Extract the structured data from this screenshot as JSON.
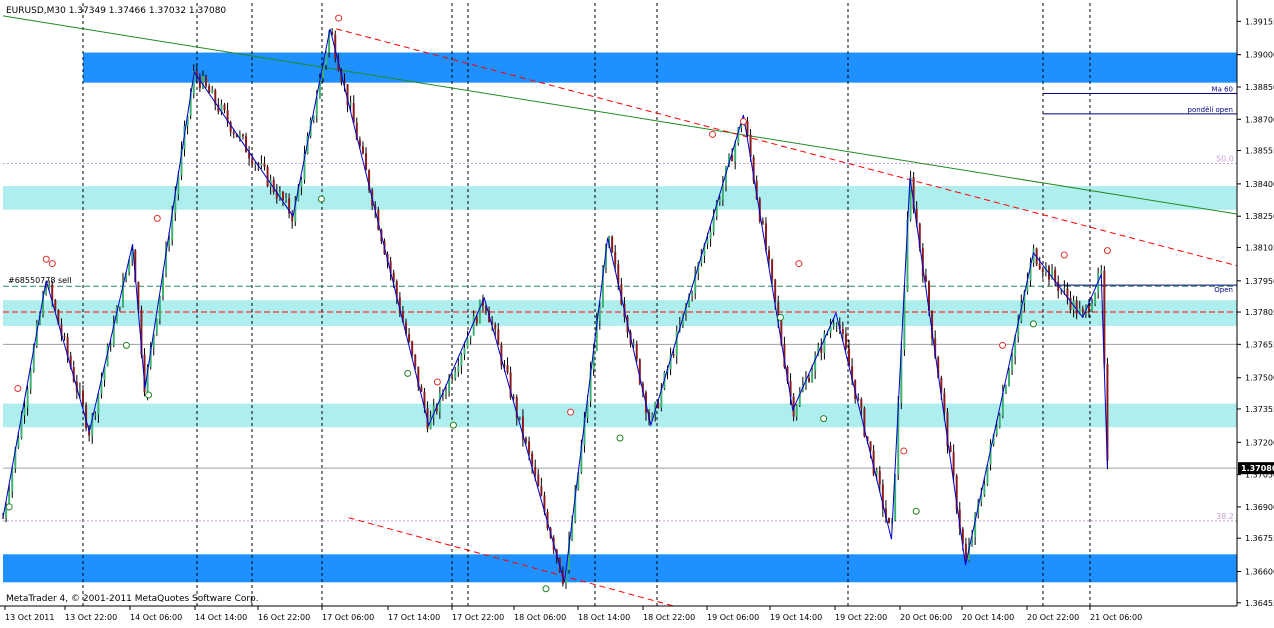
{
  "header": {
    "symbol_timeframe": "EURUSD,M30",
    "ohlc": "1.37349 1.37466 1.37032 1.37080"
  },
  "footer": {
    "copyright": "MetaTrader 4, © 2001-2011 MetaQuotes Software Corp."
  },
  "chart_data": {
    "type": "candlestick",
    "symbol": "EURUSD",
    "timeframe": "M30",
    "current_price": 1.3708,
    "current_price_label": "1.37080",
    "ylim": [
      1.3644,
      1.3924
    ],
    "y_ticks": [
      "1.39155",
      "1.39000",
      "1.38850",
      "1.38700",
      "1.38555",
      "1.38400",
      "1.38250",
      "1.38105",
      "1.37950",
      "1.37805",
      "1.37655",
      "1.37500",
      "1.37355",
      "1.37200",
      "1.37050",
      "1.36900",
      "1.36755",
      "1.36600",
      "1.36455"
    ],
    "x_labels": [
      "13 Oct 2011",
      "13 Oct 22:00",
      "14 Oct 06:00",
      "14 Oct 14:00",
      "16 Oct 22:00",
      "17 Oct 06:00",
      "17 Oct 14:00",
      "17 Oct 22:00",
      "18 Oct 06:00",
      "18 Oct 14:00",
      "18 Oct 22:00",
      "19 Oct 06:00",
      "19 Oct 14:00",
      "19 Oct 22:00",
      "20 Oct 06:00",
      "20 Oct 14:00",
      "20 Oct 22:00",
      "21 Oct 06:00"
    ],
    "zones": [
      {
        "from": 1.3887,
        "to": 1.3901,
        "color": "#1e90ff"
      },
      {
        "from": 1.3828,
        "to": 1.3839,
        "color": "#afeeee"
      },
      {
        "from": 1.3774,
        "to": 1.3786,
        "color": "#afeeee"
      },
      {
        "from": 1.3727,
        "to": 1.3738,
        "color": "#afeeee"
      },
      {
        "from": 1.3655,
        "to": 1.3668,
        "color": "#1e90ff"
      }
    ],
    "order_line": {
      "label": "#68550778 sell",
      "price": 1.37925,
      "color": "#2e8b57"
    },
    "stop_line": {
      "price": 1.37805,
      "color": "#ff0000"
    },
    "fib_levels": [
      {
        "label": "50.0",
        "price": 1.38495
      },
      {
        "label": "38.2",
        "price": 1.36835
      }
    ],
    "gray_lines": [
      1.37655,
      1.3708
    ],
    "ma_label": "Ma 60",
    "ma_price": 1.3882,
    "pond_label": "pondělí open",
    "pond_price": 1.38725,
    "open_label": "Open",
    "open_price": 1.3793,
    "trend_green": {
      "from": [
        0.0,
        1.3918
      ],
      "to": [
        1.0,
        1.3826
      ],
      "color": "#228b22"
    },
    "trend_red_upper": {
      "from": [
        0.27,
        1.3912
      ],
      "to": [
        1.0,
        1.3802
      ],
      "color": "#ff0000"
    },
    "trend_red_lower": {
      "from": [
        0.28,
        1.3685
      ],
      "to": [
        0.55,
        1.3643
      ],
      "color": "#ff0000"
    },
    "zigzag": [
      [
        0.0,
        1.3685
      ],
      [
        0.035,
        1.3795
      ],
      [
        0.07,
        1.3725
      ],
      [
        0.105,
        1.3812
      ],
      [
        0.115,
        1.3745
      ],
      [
        0.155,
        1.3892
      ],
      [
        0.235,
        1.3825
      ],
      [
        0.265,
        1.3912
      ],
      [
        0.345,
        1.3728
      ],
      [
        0.39,
        1.3787
      ],
      [
        0.455,
        1.3655
      ],
      [
        0.49,
        1.3815
      ],
      [
        0.525,
        1.3728
      ],
      [
        0.6,
        1.3872
      ],
      [
        0.64,
        1.3735
      ],
      [
        0.675,
        1.378
      ],
      [
        0.72,
        1.3675
      ],
      [
        0.735,
        1.3843
      ],
      [
        0.78,
        1.3663
      ],
      [
        0.835,
        1.3808
      ],
      [
        0.875,
        1.3778
      ],
      [
        0.89,
        1.3798
      ],
      [
        0.895,
        1.3708
      ]
    ],
    "marks_red": [
      [
        0.012,
        1.3745
      ],
      [
        0.035,
        1.3805
      ],
      [
        0.04,
        1.3803
      ],
      [
        0.125,
        1.3824
      ],
      [
        0.272,
        1.3917
      ],
      [
        0.352,
        1.3748
      ],
      [
        0.46,
        1.3734
      ],
      [
        0.575,
        1.3863
      ],
      [
        0.6,
        1.3869
      ],
      [
        0.645,
        1.3803
      ],
      [
        0.73,
        1.3716
      ],
      [
        0.81,
        1.3765
      ],
      [
        0.86,
        1.3807
      ],
      [
        0.895,
        1.3809
      ]
    ],
    "marks_green": [
      [
        0.005,
        1.369
      ],
      [
        0.1,
        1.3765
      ],
      [
        0.118,
        1.3742
      ],
      [
        0.258,
        1.3833
      ],
      [
        0.328,
        1.3752
      ],
      [
        0.365,
        1.3728
      ],
      [
        0.44,
        1.3652
      ],
      [
        0.5,
        1.3722
      ],
      [
        0.63,
        1.3778
      ],
      [
        0.665,
        1.3731
      ],
      [
        0.74,
        1.3688
      ],
      [
        0.835,
        1.3775
      ]
    ],
    "candles": "generated"
  }
}
